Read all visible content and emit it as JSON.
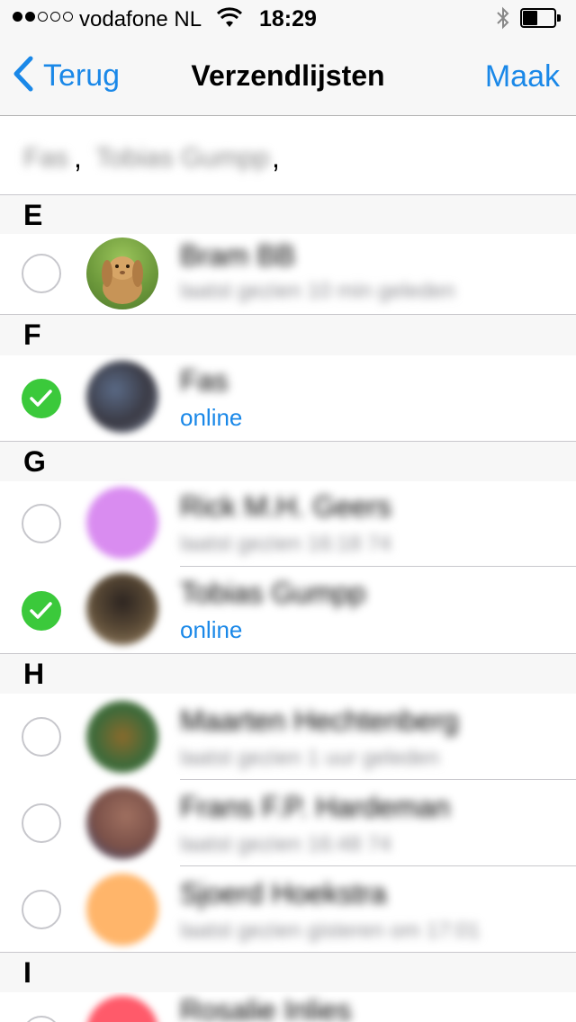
{
  "status_bar": {
    "carrier": "vodafone NL",
    "time": "18:29",
    "signal_bars_filled": 2,
    "signal_bars_total": 5,
    "battery_level": 0.4
  },
  "nav": {
    "back_label": "Terug",
    "title": "Verzendlijsten",
    "action_label": "Maak"
  },
  "recipients": [
    "Fas",
    "Tobias Gumpp"
  ],
  "sections": [
    {
      "letter": "E",
      "contacts": [
        {
          "name": "Bram BB",
          "status": "laatst gezien 10 min geleden",
          "selected": false,
          "online": false
        }
      ]
    },
    {
      "letter": "F",
      "contacts": [
        {
          "name": "Fas",
          "status": "online",
          "selected": true,
          "online": true
        }
      ]
    },
    {
      "letter": "G",
      "contacts": [
        {
          "name": "Rick M.H. Geers",
          "status": "laatst gezien 16:18 74",
          "selected": false,
          "online": false
        },
        {
          "name": "Tobias Gumpp",
          "status": "online",
          "selected": true,
          "online": true
        }
      ]
    },
    {
      "letter": "H",
      "contacts": [
        {
          "name": "Maarten Hechtenberg",
          "status": "laatst gezien 1 uur geleden",
          "selected": false,
          "online": false
        },
        {
          "name": "Frans F.P. Hardeman",
          "status": "laatst gezien 16:48 74",
          "selected": false,
          "online": false
        },
        {
          "name": "Sjoerd Hoekstra",
          "status": "laatst gezien gisteren om 17:01",
          "selected": false,
          "online": false
        }
      ]
    },
    {
      "letter": "I",
      "contacts": [
        {
          "name": "Rosalie Inlies",
          "status": "",
          "selected": false,
          "online": false
        }
      ]
    }
  ],
  "colors": {
    "accent": "#1a88e8",
    "check_on": "#3bc93b",
    "section_bg": "#f7f7f7"
  }
}
